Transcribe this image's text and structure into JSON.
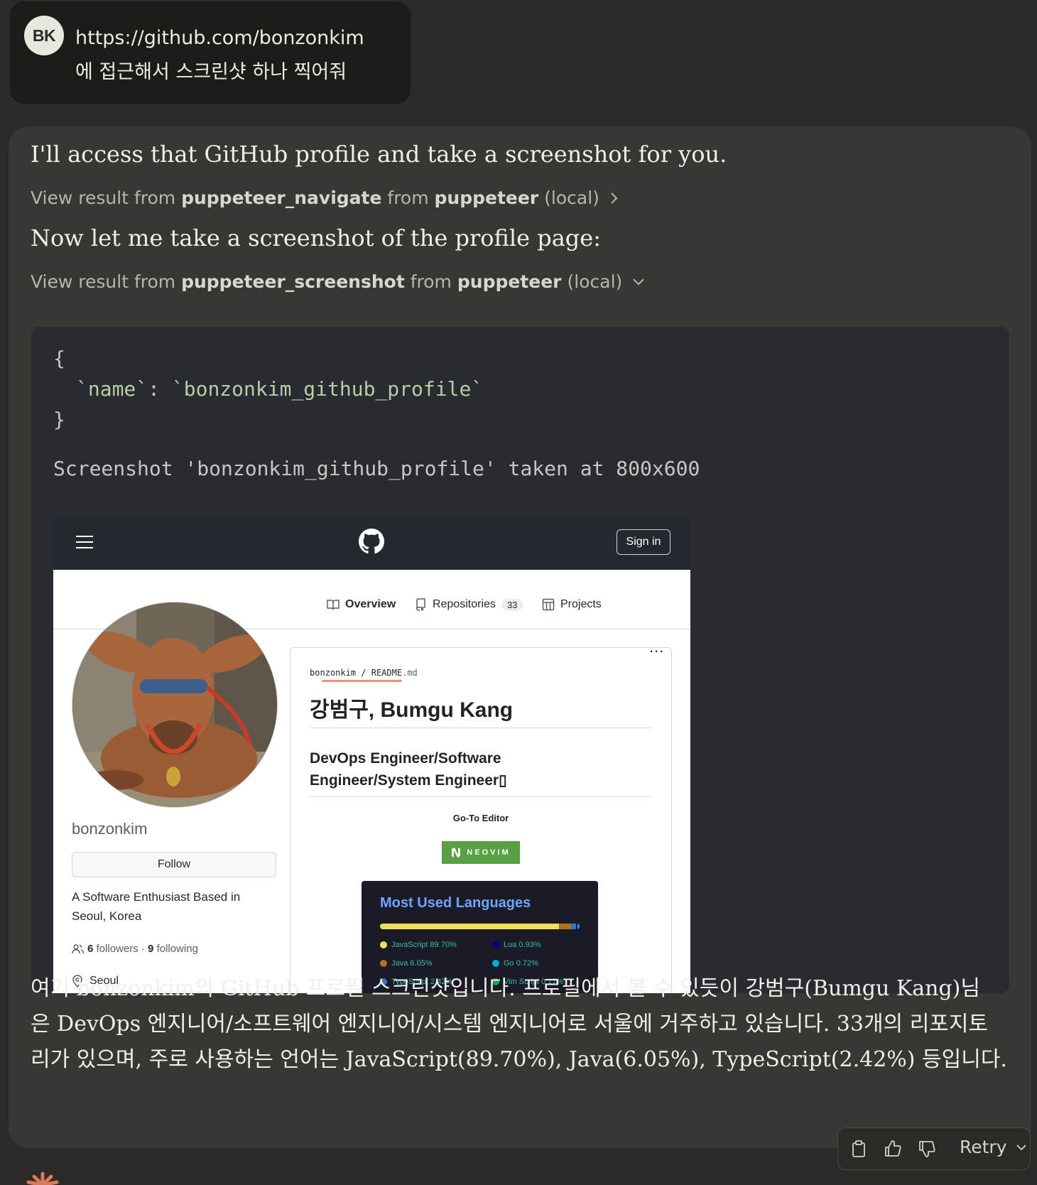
{
  "user_message": {
    "avatar_initials": "BK",
    "line1": "https://github.com/bonzonkim",
    "line2": "에 접근해서 스크린샷 하나 찍어줘"
  },
  "assistant": {
    "intro": "I'll access that GitHub profile and take a screenshot for you.",
    "tool1": {
      "prefix": "View result from ",
      "tool": "puppeteer_navigate",
      "mid": " from ",
      "server": "puppeteer",
      "suffix": " (local)"
    },
    "middle": "Now let me take a screenshot of the profile page:",
    "tool2": {
      "prefix": "View result from ",
      "tool": "puppeteer_screenshot",
      "mid": " from ",
      "server": "puppeteer",
      "suffix": " (local)"
    },
    "code": {
      "open": "{",
      "key": "`name`",
      "sep": ": ",
      "value": "`bonzonkim_github_profile`",
      "close": "}",
      "result": "Screenshot 'bonzonkim_github_profile' taken at 800x600"
    },
    "summary_lines": [
      "여기 bonzonkim의 GitHub 프로필 스크린샷입니다. 프로필에서 볼 수 있듯이 강범구(Bumgu Kang)님",
      "은 DevOps 엔지니어/소프트웨어 엔지니어/시스템 엔지니어로 서울에 거주하고 있습니다. 33개의 리포지토",
      "리가 있으며, 주로 사용하는 언어는 JavaScript(89.70%), Java(6.05%), TypeScript(2.42%) 등입니다."
    ]
  },
  "github": {
    "sign_in": "Sign in",
    "tabs": {
      "overview": "Overview",
      "repositories": "Repositories",
      "repo_count": "33",
      "projects": "Projects"
    },
    "more": "...",
    "username": "bonzonkim",
    "follow": "Follow",
    "bio": "A Software Enthusiast Based in Seoul, Korea",
    "followers_count": "6",
    "followers_label": "followers",
    "separator": "·",
    "following_count": "9",
    "following_label": "following",
    "location": "Seoul",
    "readme": {
      "owner": "bonzonkim",
      "slash": "/",
      "file": "README",
      "ext": ".md",
      "h1": "강범구, Bumgu Kang",
      "h2": "DevOps Engineer/Software Engineer/System Engineer▯",
      "goto": "Go-To Editor",
      "badge": "NEOVIM"
    },
    "languages": {
      "title": "Most Used Languages",
      "items": [
        {
          "name": "JavaScript",
          "percent": "89.70%",
          "value": 89.7,
          "color": "#f1e05a"
        },
        {
          "name": "Java",
          "percent": "6.05%",
          "value": 6.05,
          "color": "#b07219"
        },
        {
          "name": "TypeScript",
          "percent": "2.42%",
          "value": 2.42,
          "color": "#3178c6"
        },
        {
          "name": "Lua",
          "percent": "0.93%",
          "value": 0.93,
          "color": "#000080"
        },
        {
          "name": "Go",
          "percent": "0.72%",
          "value": 0.72,
          "color": "#00add8"
        },
        {
          "name": "Vim Script",
          "percent": "0.17%",
          "value": 0.17,
          "color": "#199f4b"
        }
      ]
    }
  },
  "actions": {
    "retry": "Retry",
    "icons": [
      "copy-icon",
      "thumbs-up-icon",
      "thumbs-down-icon",
      "chevron-down-icon"
    ]
  }
}
